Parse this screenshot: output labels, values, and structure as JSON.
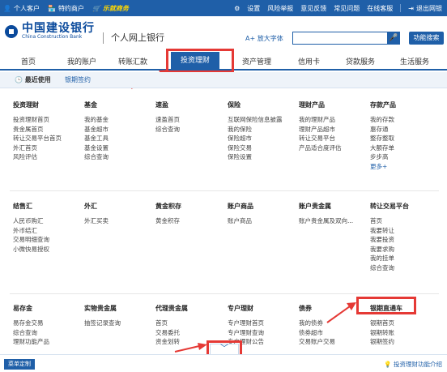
{
  "topbar": {
    "personal": "个人客户",
    "special": "特约商户",
    "promo": "乐就商务",
    "right_links": [
      "设置",
      "风险举报",
      "意见反馈",
      "常见问题",
      "在线客服"
    ],
    "logout": "退出网银"
  },
  "header": {
    "logo_cn": "中国建设银行",
    "logo_en": "China Construction Bank",
    "portal_title": "个人网上银行",
    "font_toggle": "A+ 放大字体",
    "search_placeholder": "",
    "mic_icon": "microphone-icon",
    "search_button": "功能搜索"
  },
  "nav": {
    "tabs": [
      "首页",
      "我的账户",
      "转账汇款",
      "投资理财",
      "资产管理",
      "信用卡",
      "贷款服务",
      "生活服务"
    ],
    "active": "投资理财"
  },
  "subnav": {
    "recent": "最近使用",
    "contract": "银期签约"
  },
  "sections": [
    {
      "title": "投资理财",
      "links": [
        "投资理财首页",
        "贵金属首页",
        "转让交易平台首页",
        "外汇首页",
        "风险评估"
      ]
    },
    {
      "title": "基金",
      "links": [
        "我的基金",
        "基金超市",
        "基金工具",
        "基金设置",
        "综合查询"
      ]
    },
    {
      "title": "速盈",
      "links": [
        "速盈首页",
        "综合查询"
      ]
    },
    {
      "title": "保险",
      "links": [
        "互联网保险信息披露",
        "我的保险",
        "保险超市",
        "保险交易",
        "保险设置"
      ]
    },
    {
      "title": "理财产品",
      "links": [
        "我的理财产品",
        "理财产品超市",
        "转让交易平台",
        "产品适合度评估"
      ]
    },
    {
      "title": "存款产品",
      "links": [
        "我的存款",
        "惠存通",
        "整存整取",
        "大额存单",
        "步步高",
        "更多+"
      ]
    },
    {
      "title": "结售汇",
      "links": [
        "人民币购汇",
        "外币结汇",
        "交易明细查询",
        "小微快易授权"
      ]
    },
    {
      "title": "外汇",
      "links": [
        "外汇买卖"
      ]
    },
    {
      "title": "黄金积存",
      "links": [
        "黄金积存"
      ]
    },
    {
      "title": "账户商品",
      "links": [
        "账户商品"
      ]
    },
    {
      "title": "账户贵金属",
      "links": [
        "账户贵金属及双向..."
      ]
    },
    {
      "title": "转让交易平台",
      "links": [
        "首页",
        "我要转让",
        "我要投资",
        "我要求购",
        "我的挂单",
        "综合查询"
      ]
    },
    {
      "title": "易存金",
      "links": [
        "易存金交易",
        "综合查询",
        "理财功能产品"
      ]
    },
    {
      "title": "实物贵金属",
      "links": [
        "抽签记录查询"
      ]
    },
    {
      "title": "代理贵金属",
      "links": [
        "首页",
        "交易委托",
        "资金划转"
      ]
    },
    {
      "title": "专户理财",
      "links": [
        "专户理财首页",
        "专户理财查询",
        "专户理财公告"
      ]
    },
    {
      "title": "债券",
      "links": [
        "我的债券",
        "债券超市",
        "交易账户交易"
      ]
    },
    {
      "title": "银期直通车",
      "links": [
        "银期首页",
        "银期转账",
        "银期签约"
      ]
    }
  ],
  "bottom": {
    "menu_custom": "菜单定制",
    "intro": "投资理财功能介绍"
  }
}
